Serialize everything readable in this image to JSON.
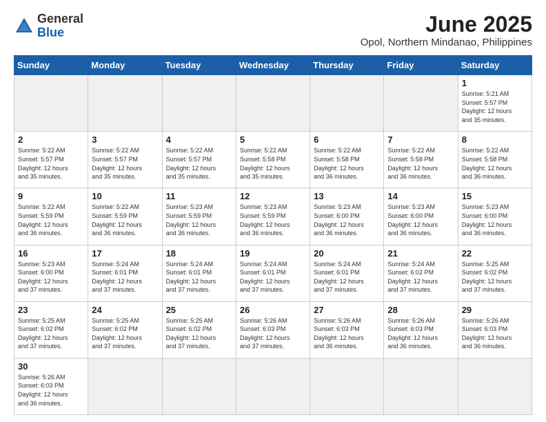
{
  "logo": {
    "general": "General",
    "blue": "Blue"
  },
  "title": "June 2025",
  "subtitle": "Opol, Northern Mindanao, Philippines",
  "weekdays": [
    "Sunday",
    "Monday",
    "Tuesday",
    "Wednesday",
    "Thursday",
    "Friday",
    "Saturday"
  ],
  "days": [
    {
      "num": "",
      "empty": true
    },
    {
      "num": "",
      "empty": true
    },
    {
      "num": "",
      "empty": true
    },
    {
      "num": "",
      "empty": true
    },
    {
      "num": "",
      "empty": true
    },
    {
      "num": "",
      "empty": true
    },
    {
      "num": "1",
      "rise": "5:21 AM",
      "set": "5:57 PM",
      "hours": "12 hours",
      "mins": "35 minutes."
    },
    {
      "num": "2",
      "rise": "5:22 AM",
      "set": "5:57 PM",
      "hours": "12 hours",
      "mins": "35 minutes."
    },
    {
      "num": "3",
      "rise": "5:22 AM",
      "set": "5:57 PM",
      "hours": "12 hours",
      "mins": "35 minutes."
    },
    {
      "num": "4",
      "rise": "5:22 AM",
      "set": "5:57 PM",
      "hours": "12 hours",
      "mins": "35 minutes."
    },
    {
      "num": "5",
      "rise": "5:22 AM",
      "set": "5:58 PM",
      "hours": "12 hours",
      "mins": "35 minutes."
    },
    {
      "num": "6",
      "rise": "5:22 AM",
      "set": "5:58 PM",
      "hours": "12 hours",
      "mins": "36 minutes."
    },
    {
      "num": "7",
      "rise": "5:22 AM",
      "set": "5:58 PM",
      "hours": "12 hours",
      "mins": "36 minutes."
    },
    {
      "num": "8",
      "rise": "5:22 AM",
      "set": "5:58 PM",
      "hours": "12 hours",
      "mins": "36 minutes."
    },
    {
      "num": "9",
      "rise": "5:22 AM",
      "set": "5:59 PM",
      "hours": "12 hours",
      "mins": "36 minutes."
    },
    {
      "num": "10",
      "rise": "5:22 AM",
      "set": "5:59 PM",
      "hours": "12 hours",
      "mins": "36 minutes."
    },
    {
      "num": "11",
      "rise": "5:23 AM",
      "set": "5:59 PM",
      "hours": "12 hours",
      "mins": "36 minutes."
    },
    {
      "num": "12",
      "rise": "5:23 AM",
      "set": "5:59 PM",
      "hours": "12 hours",
      "mins": "36 minutes."
    },
    {
      "num": "13",
      "rise": "5:23 AM",
      "set": "6:00 PM",
      "hours": "12 hours",
      "mins": "36 minutes."
    },
    {
      "num": "14",
      "rise": "5:23 AM",
      "set": "6:00 PM",
      "hours": "12 hours",
      "mins": "36 minutes."
    },
    {
      "num": "15",
      "rise": "5:23 AM",
      "set": "6:00 PM",
      "hours": "12 hours",
      "mins": "36 minutes."
    },
    {
      "num": "16",
      "rise": "5:23 AM",
      "set": "6:00 PM",
      "hours": "12 hours",
      "mins": "37 minutes."
    },
    {
      "num": "17",
      "rise": "5:24 AM",
      "set": "6:01 PM",
      "hours": "12 hours",
      "mins": "37 minutes."
    },
    {
      "num": "18",
      "rise": "5:24 AM",
      "set": "6:01 PM",
      "hours": "12 hours",
      "mins": "37 minutes."
    },
    {
      "num": "19",
      "rise": "5:24 AM",
      "set": "6:01 PM",
      "hours": "12 hours",
      "mins": "37 minutes."
    },
    {
      "num": "20",
      "rise": "5:24 AM",
      "set": "6:01 PM",
      "hours": "12 hours",
      "mins": "37 minutes."
    },
    {
      "num": "21",
      "rise": "5:24 AM",
      "set": "6:02 PM",
      "hours": "12 hours",
      "mins": "37 minutes."
    },
    {
      "num": "22",
      "rise": "5:25 AM",
      "set": "6:02 PM",
      "hours": "12 hours",
      "mins": "37 minutes."
    },
    {
      "num": "23",
      "rise": "5:25 AM",
      "set": "6:02 PM",
      "hours": "12 hours",
      "mins": "37 minutes."
    },
    {
      "num": "24",
      "rise": "5:25 AM",
      "set": "6:02 PM",
      "hours": "12 hours",
      "mins": "37 minutes."
    },
    {
      "num": "25",
      "rise": "5:25 AM",
      "set": "6:02 PM",
      "hours": "12 hours",
      "mins": "37 minutes."
    },
    {
      "num": "26",
      "rise": "5:26 AM",
      "set": "6:03 PM",
      "hours": "12 hours",
      "mins": "37 minutes."
    },
    {
      "num": "27",
      "rise": "5:26 AM",
      "set": "6:03 PM",
      "hours": "12 hours",
      "mins": "36 minutes."
    },
    {
      "num": "28",
      "rise": "5:26 AM",
      "set": "6:03 PM",
      "hours": "12 hours",
      "mins": "36 minutes."
    },
    {
      "num": "29",
      "rise": "5:26 AM",
      "set": "6:03 PM",
      "hours": "12 hours",
      "mins": "36 minutes."
    },
    {
      "num": "30",
      "rise": "5:26 AM",
      "set": "6:03 PM",
      "hours": "12 hours",
      "mins": "36 minutes."
    },
    {
      "num": "",
      "empty": true
    },
    {
      "num": "",
      "empty": true
    },
    {
      "num": "",
      "empty": true
    },
    {
      "num": "",
      "empty": true
    },
    {
      "num": "",
      "empty": true
    }
  ]
}
